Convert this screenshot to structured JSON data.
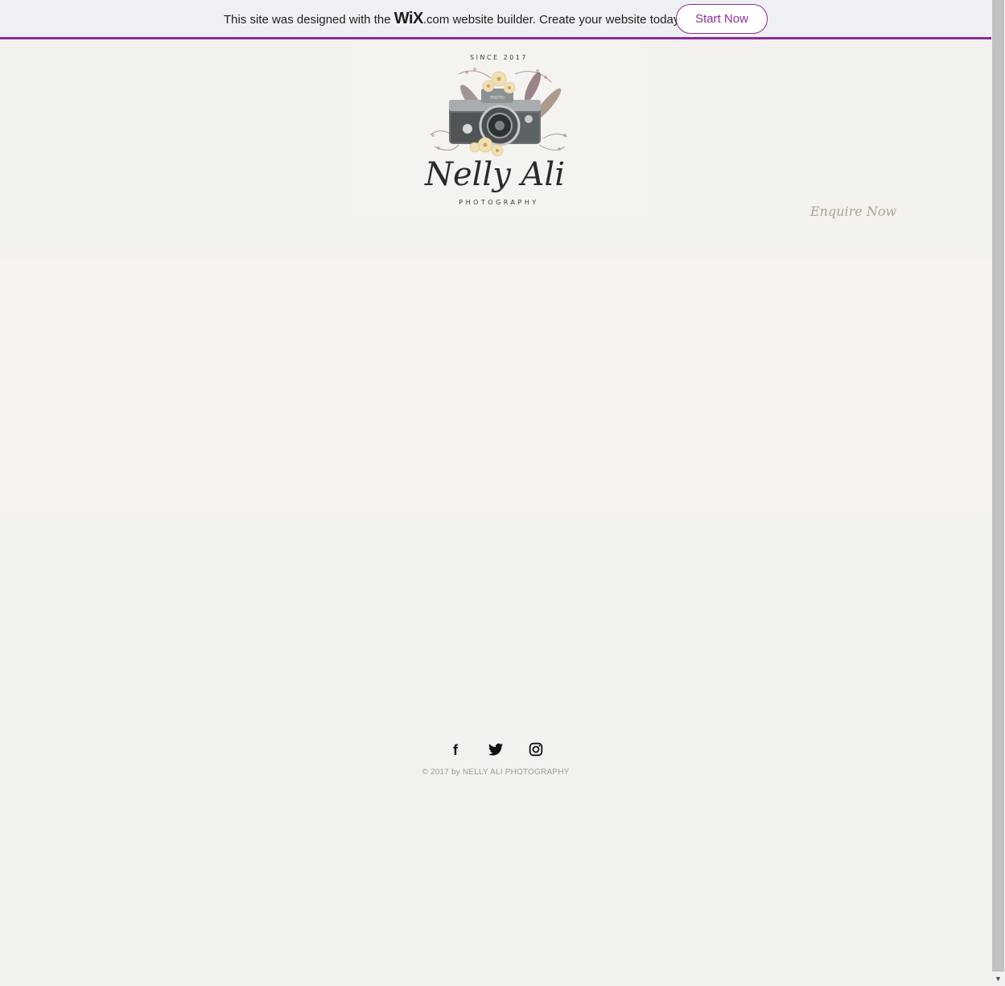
{
  "banner": {
    "text_before": "This site was designed with the ",
    "logo": "WiX",
    "text_after": ".com website builder. Create your website today.",
    "button_label": "Start Now",
    "accent_color": "#8d2c97"
  },
  "logo": {
    "since": "SINCE 2017",
    "name": "Nelly Ali",
    "tagline": "PHOTOGRAPHY",
    "camera_label": "PHOTO"
  },
  "nav": {
    "enquire_label": "Enquire Now"
  },
  "footer": {
    "social": [
      {
        "name": "facebook-icon",
        "glyph": "f"
      },
      {
        "name": "twitter-icon"
      },
      {
        "name": "instagram-icon"
      }
    ],
    "copyright": "© 2017 by  NELLY ALI PHOTOGRAPHY"
  }
}
